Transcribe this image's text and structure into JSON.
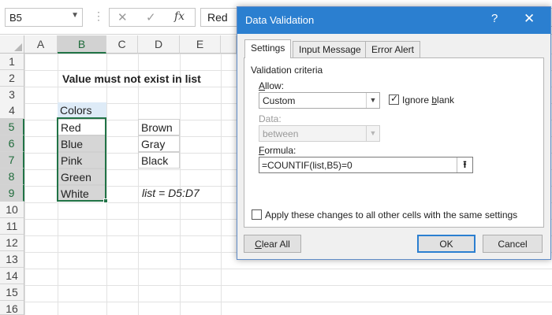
{
  "formula_bar": {
    "name_box": "B5",
    "cancel_icon": "✕",
    "enter_icon": "✓",
    "fx_icon": "fx",
    "content": "Red"
  },
  "sheet": {
    "columns": [
      "A",
      "B",
      "C",
      "D",
      "E"
    ],
    "rows": [
      "1",
      "2",
      "3",
      "4",
      "5",
      "6",
      "7",
      "8",
      "9",
      "10",
      "11",
      "12",
      "13",
      "14",
      "15",
      "16"
    ],
    "title": "Value must not exist in list",
    "colors_header": "Colors",
    "colors": [
      "Red",
      "Blue",
      "Pink",
      "Green",
      "White"
    ],
    "list_values": [
      "Brown",
      "Gray",
      "Black"
    ],
    "note": "list = D5:D7"
  },
  "dialog": {
    "title": "Data Validation",
    "help": "?",
    "close": "✕",
    "tabs": [
      "Settings",
      "Input Message",
      "Error Alert"
    ],
    "group_label": "Validation criteria",
    "allow_label_pre": "",
    "allow_label_ul": "A",
    "allow_label_post": "llow:",
    "allow_value": "Custom",
    "ignore_blank_pre": "Ignore ",
    "ignore_blank_ul": "b",
    "ignore_blank_post": "lank",
    "data_label": "Data:",
    "data_value": "between",
    "formula_label_ul": "F",
    "formula_label_post": "ormula:",
    "formula_value": "=COUNTIF(list,B5)=0",
    "apply_pre": "Apply these changes to all other cells with the same settings",
    "apply_ul": "p",
    "buttons": {
      "clear_all_ul": "C",
      "clear_all_post": "lear All",
      "ok": "OK",
      "cancel": "Cancel"
    }
  },
  "colors": {
    "accent": "#2b7fd0",
    "excel_green": "#217346",
    "header_fill": "#deebf7",
    "selection_fill": "#d6d6d6"
  }
}
